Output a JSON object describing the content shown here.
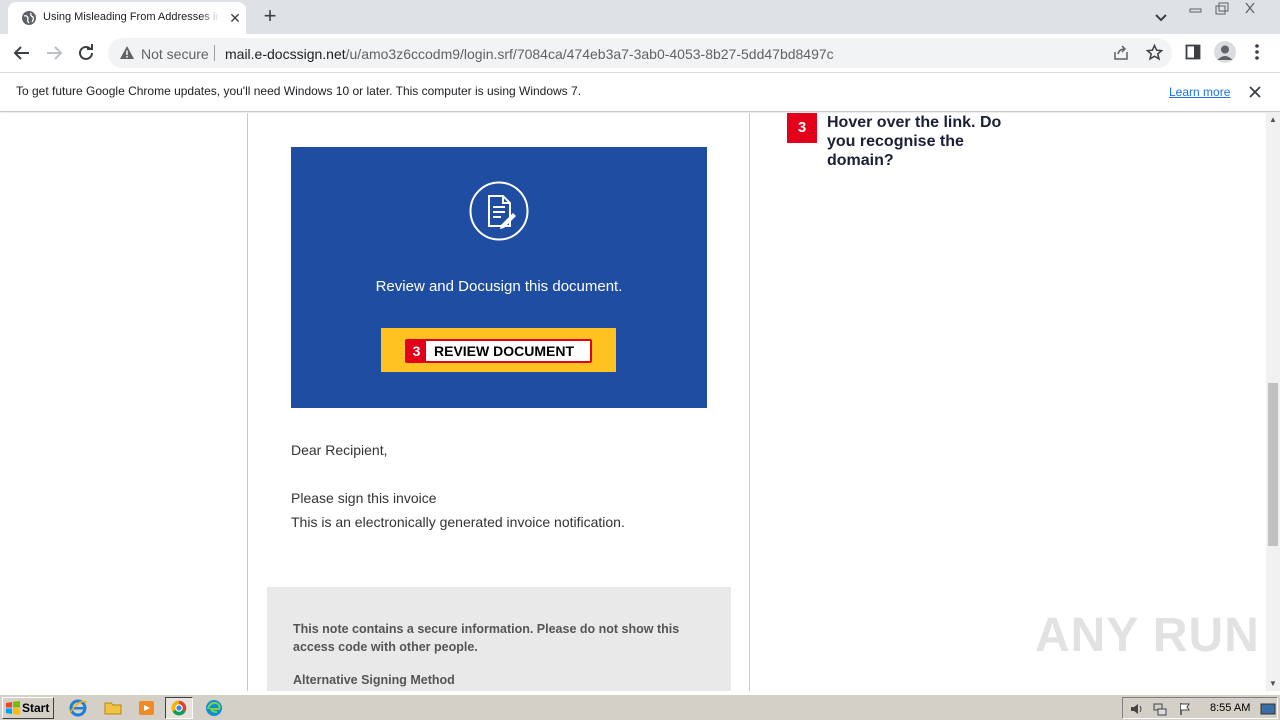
{
  "browser": {
    "tab": {
      "title": "Using Misleading From Addresses in P",
      "close_label": "✕"
    },
    "new_tab_label": "+",
    "omnibox": {
      "security_label": "Not secure",
      "url_host": "mail.e-docssign.net",
      "url_path": "/u/amo3z6ccodm9/login.srf/7084ca/474eb3a7-3ab0-4053-8b27-5dd47bd8497c"
    },
    "infobar": {
      "message": "To get future Google Chrome updates, you'll need Windows 10 or later. This computer is using Windows 7.",
      "learn_more": "Learn more"
    }
  },
  "email": {
    "hero_text": "Review and Docusign this document.",
    "review_button": {
      "badge": "3",
      "label": "REVIEW DOCUMENT",
      "button_color": "#ffc221",
      "badge_color": "#e3001b"
    },
    "hero_color": "#1f4da1",
    "greeting": "Dear Recipient,",
    "body_lines": [
      "Please sign this invoice",
      "This is an electronically generated invoice notification."
    ],
    "note": {
      "text": "This note contains a secure information. Please do not show this access code with other people.",
      "alt_heading": "Alternative Signing Method"
    }
  },
  "tip": {
    "badge": "3",
    "text": "Hover over the link. Do you recognise the domain?"
  },
  "watermark": "ANY RUN",
  "taskbar": {
    "start_label": "Start",
    "apps": [
      "internet-explorer-icon",
      "file-explorer-icon",
      "media-player-icon",
      "chrome-icon",
      "edge-icon"
    ],
    "clock": "8:55 AM"
  }
}
